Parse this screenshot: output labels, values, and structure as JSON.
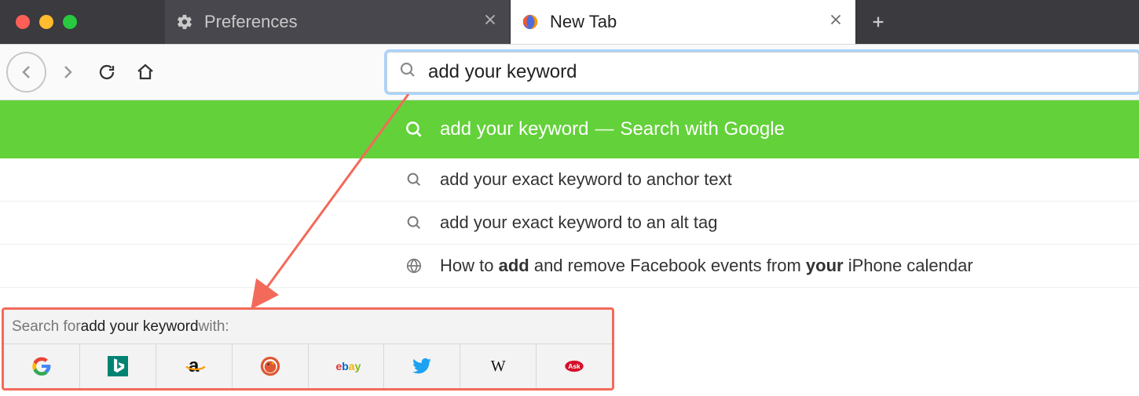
{
  "tabs": [
    {
      "label": "Preferences",
      "icon": "gear-icon"
    },
    {
      "label": "New Tab",
      "icon": "firefox-icon"
    }
  ],
  "urlbar": {
    "value": "add your keyword"
  },
  "suggestions": {
    "highlighted": {
      "text": "add your keyword",
      "action": "Search with Google"
    },
    "items": [
      {
        "type": "search",
        "text": "add your exact keyword to anchor text"
      },
      {
        "type": "search",
        "text": "add your exact keyword to an alt tag"
      },
      {
        "type": "page",
        "prefix": "How to ",
        "bold1": "add",
        "mid": " and remove Facebook events from ",
        "bold2": "your",
        "suffix": " iPhone calendar"
      }
    ]
  },
  "engine_panel": {
    "prefix": "Search for ",
    "keyword": "add your keyword",
    "suffix": " with:",
    "engines": [
      "google",
      "bing",
      "amazon",
      "duckduckgo",
      "ebay",
      "twitter",
      "wikipedia",
      "ask"
    ]
  },
  "colors": {
    "highlight_green": "#63d13a",
    "annotation_red": "#f36a5a"
  }
}
